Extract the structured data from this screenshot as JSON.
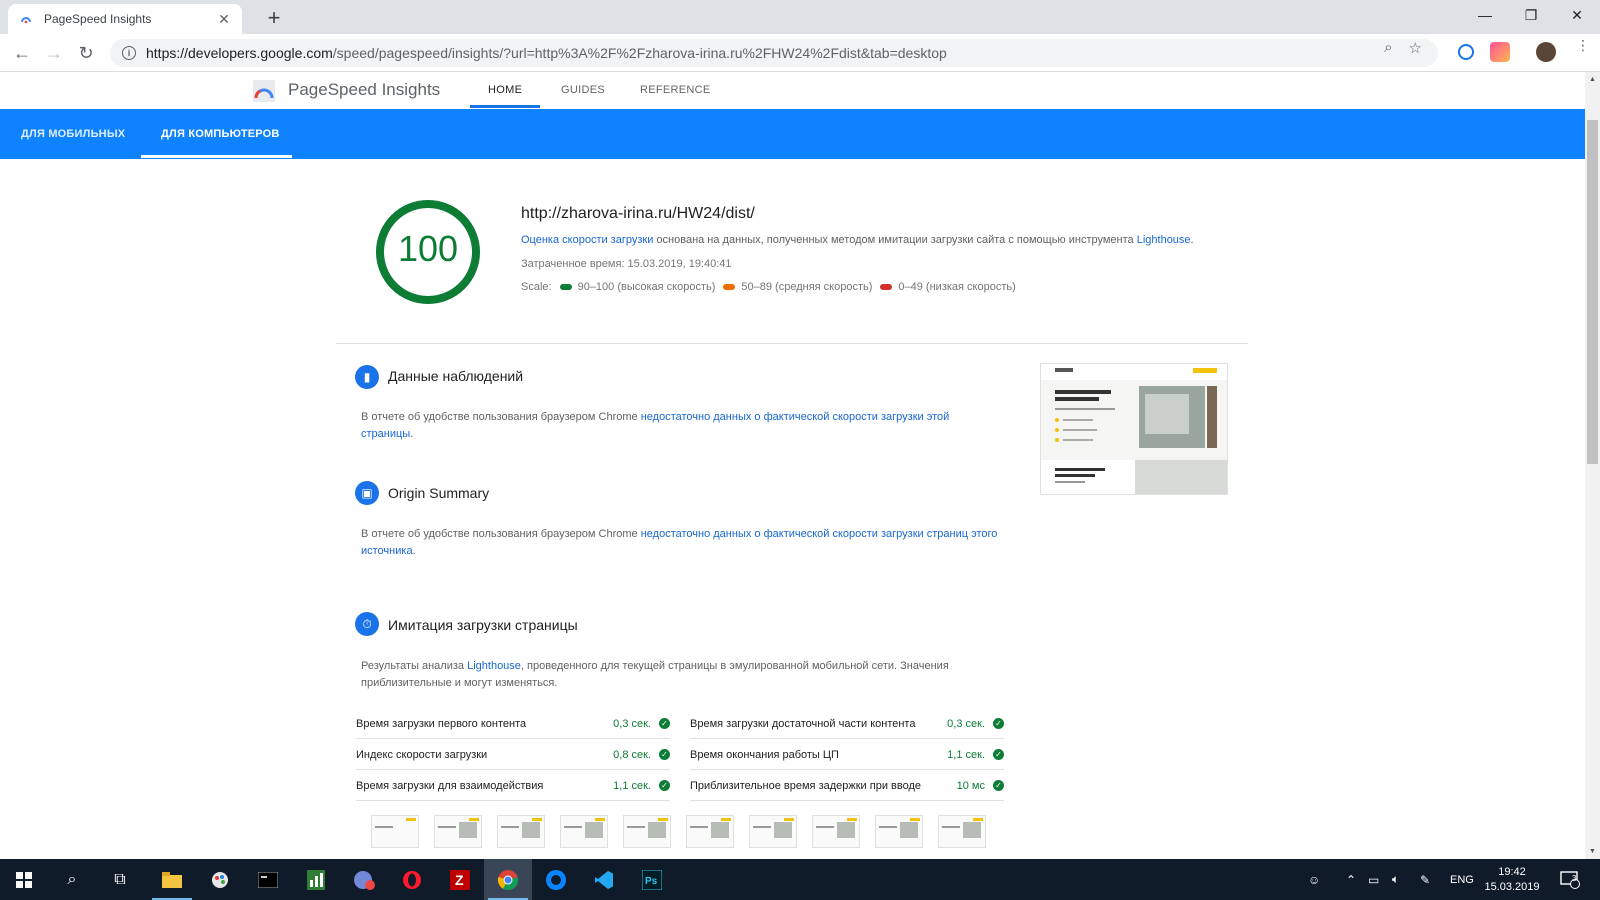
{
  "browser": {
    "tab_title": "PageSpeed Insights",
    "tab_close": "✕",
    "new_tab": "+",
    "url_host": "https://developers.google.com",
    "url_path": "/speed/pagespeed/insights/?url=http%3A%2F%2Fzharova-irina.ru%2FHW24%2Fdist&tab=desktop",
    "window_controls": {
      "minimize": "—",
      "restore": "❐",
      "close": "✕"
    }
  },
  "psi": {
    "brand": "PageSpeed Insights",
    "nav": [
      "HOME",
      "GUIDES",
      "REFERENCE"
    ],
    "device_tabs": [
      "ДЛЯ МОБИЛЬНЫХ",
      "ДЛЯ КОМПЬЮТЕРОВ"
    ]
  },
  "summary": {
    "score": "100",
    "score_value": 100,
    "score_color": "#0d7c35",
    "tested_url": "http://zharova-irina.ru/HW24/dist/",
    "desc_link": "Оценка скорости загрузки",
    "desc_text": " основана на данных, полученных методом имитации загрузки сайта с помощью инструмента ",
    "desc_link2": "Lighthouse",
    "desc_end": ".",
    "time_label": "Затраченное время: 15.03.2019, 19:40:41",
    "scale_label": "Scale:",
    "scale_items": [
      {
        "label": "90–100 (высокая скорость)",
        "color": "#0d7c35"
      },
      {
        "label": "50–89 (средняя скорость)",
        "color": "#ef6c00"
      },
      {
        "label": "0–49 (низкая скорость)",
        "color": "#d32f2f"
      }
    ]
  },
  "field_data": {
    "title": "Данные наблюдений",
    "text": "В отчете об удобстве пользования браузером Chrome ",
    "link": "недостаточно данных о фактической скорости загрузки этой страницы",
    "end": "."
  },
  "origin_summary": {
    "title": "Origin Summary",
    "text": "В отчете об удобстве пользования браузером Chrome ",
    "link": "недостаточно данных о фактической скорости загрузки страниц этого источника",
    "end": "."
  },
  "lab_data": {
    "title": "Имитация загрузки страницы",
    "text": "Результаты анализа ",
    "link": "Lighthouse",
    "text2": ", проведенного для текущей страницы в эмулированной мобильной сети. Значения приблизительные и могут изменяться.",
    "metrics_left": [
      {
        "name": "Время загрузки первого контента",
        "value": "0,3 сек."
      },
      {
        "name": "Индекс скорости загрузки",
        "value": "0,8 сек."
      },
      {
        "name": "Время загрузки для взаимодействия",
        "value": "1,1 сек."
      }
    ],
    "metrics_right": [
      {
        "name": "Время загрузки достаточной части контента",
        "value": "0,3 сек."
      },
      {
        "name": "Время окончания работы ЦП",
        "value": "1,1 сек."
      },
      {
        "name": "Приблизительное время задержки при вводе",
        "value": "10 мс"
      }
    ]
  },
  "taskbar": {
    "lang": "ENG",
    "time": "19:42",
    "date": "15.03.2019",
    "notifications": "3"
  }
}
